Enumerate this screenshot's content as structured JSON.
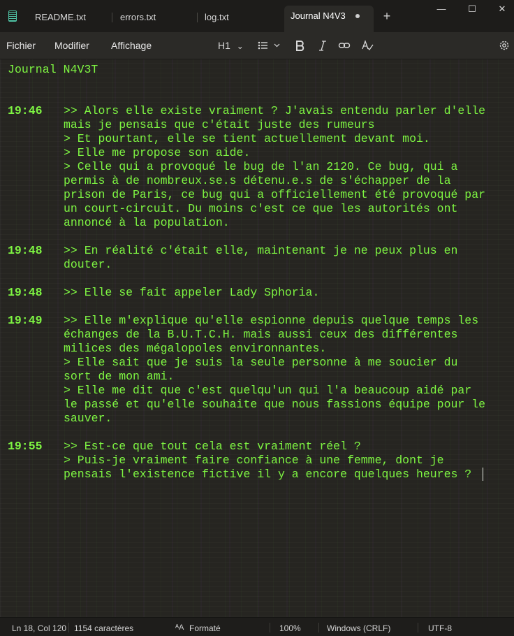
{
  "tabs": [
    {
      "label": "README.txt",
      "active": false
    },
    {
      "label": "errors.txt",
      "active": false
    },
    {
      "label": "log.txt",
      "active": false
    },
    {
      "label": "Journal N4V3",
      "active": true,
      "unsaved": true
    }
  ],
  "new_tab_label": "+",
  "window_controls": {
    "minimize": "—",
    "maximize": "☐",
    "close": "✕"
  },
  "menu": {
    "file": "Fichier",
    "edit": "Modifier",
    "view": "Affichage"
  },
  "toolbar": {
    "heading": "H1",
    "heading_arrow": "⌄",
    "list_arrow": "⌄"
  },
  "document": {
    "title": "Journal N4V3T",
    "entries": [
      {
        "time": "19:46",
        "lines": [
          ">> Alors elle existe vraiment ? J'avais entendu parler d'elle",
          "mais je pensais que c'était juste des rumeurs",
          "> Et pourtant, elle se tient actuellement devant moi.",
          "> Elle me propose son aide.",
          "> Celle qui a provoqué le bug de l'an 2120. Ce bug, qui a",
          "permis à de nombreux.se.s détenu.e.s de s'échapper de la",
          "prison de Paris, ce bug qui a officiellement été provoqué par",
          "un court-circuit. Du moins c'est ce que les autorités ont",
          "annoncé à la population."
        ]
      },
      {
        "time": "19:48",
        "lines": [
          ">> En réalité c'était elle, maintenant je ne peux plus en",
          "douter."
        ]
      },
      {
        "time": "19:48",
        "lines": [
          ">> Elle se fait appeler Lady Sphoria."
        ]
      },
      {
        "time": "19:49",
        "lines": [
          ">> Elle m'explique qu'elle espionne depuis quelque temps les",
          "échanges de la B.U.T.C.H. mais aussi ceux des différentes",
          "milices des mégalopoles environnantes.",
          "> Elle sait que je suis la seule personne à me soucier du",
          "sort de mon ami.",
          "> Elle me dit que c'est quelqu'un qui l'a beaucoup aidé par",
          "le passé et qu'elle souhaite que nous fassions équipe pour le",
          "sauver."
        ]
      },
      {
        "time": "19:55",
        "lines": [
          ">> Est-ce que tout cela est vraiment réel ?",
          "> Puis-je vraiment faire confiance à une femme, dont je",
          "pensais l'existence fictive il y a encore quelques heures ?"
        ]
      }
    ]
  },
  "status": {
    "position": "Ln 18, Col 120",
    "chars": "1154 caractères",
    "format": "Formaté",
    "zoom": "100%",
    "line_ending": "Windows (CRLF)",
    "encoding": "UTF-8"
  },
  "colors": {
    "text": "#7ef542",
    "background": "#262521"
  }
}
